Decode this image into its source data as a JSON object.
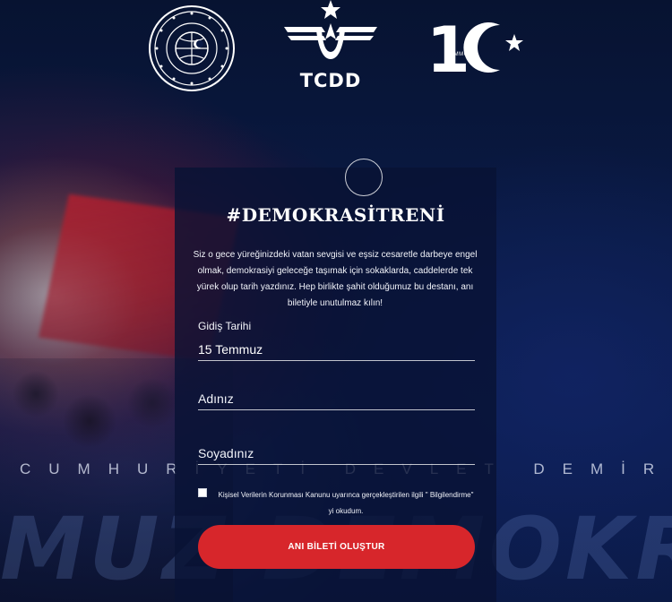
{
  "header": {
    "ministry_logo": "ministry-seal-logo",
    "ministry_logo_text": "T.C. ULAŞTIRMA VE ALTYAPI BAKANLIĞI",
    "tcdd_logo_text": "TCDD",
    "anniversary_logo_number": "15",
    "anniversary_logo_sub": "TEMMUZ"
  },
  "background": {
    "band_text": "CUMHURİYETİ DEVLET DEMİR",
    "script_text": "MUZ DEMOKRA"
  },
  "form": {
    "title": "#DEMOKRASİTRENİ",
    "intro": "Siz o gece yüreğinizdeki vatan sevgisi ve eşsiz cesaretle darbeye engel olmak, demokrasiyi geleceğe taşımak için sokaklarda, caddelerde tek yürek olup tarih yazdınız. Hep birlikte şahit olduğumuz bu destanı, anı biletiyle unutulmaz kılın!",
    "departure_label": "Gidiş Tarihi",
    "departure_value": "15 Temmuz",
    "name_placeholder": "Adınız",
    "surname_placeholder": "Soyadınız",
    "consent_text": "Kişisel Verilerin Korunması Kanunu uyarınca gerçekleştirilen ilgili \" Bilgilendirme\" yi okudum.",
    "submit_label": "ANI BİLETİ OLUŞTUR"
  },
  "colors": {
    "background": "#0a1a45",
    "panel": "#08123a",
    "accent_red": "#d7262b",
    "text": "#ffffff"
  }
}
